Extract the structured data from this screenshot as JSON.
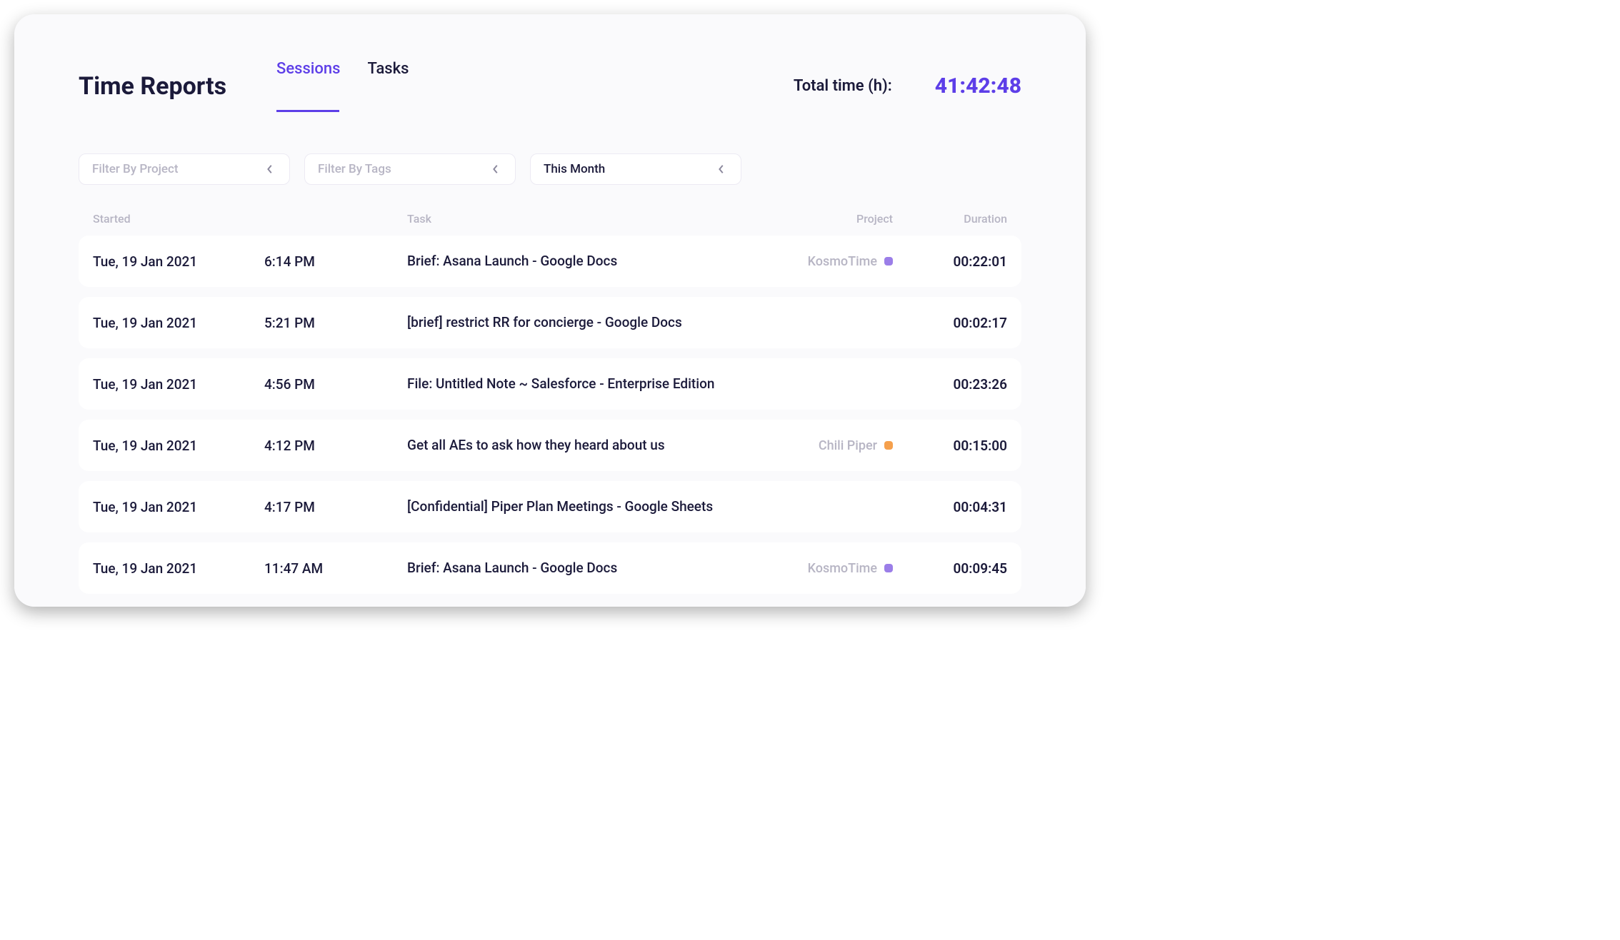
{
  "header": {
    "title": "Time Reports",
    "tabs": [
      {
        "label": "Sessions",
        "active": true
      },
      {
        "label": "Tasks",
        "active": false
      }
    ],
    "total_time_label": "Total time (h):",
    "total_time_value": "41:42:48"
  },
  "filters": {
    "project": {
      "placeholder": "Filter By Project",
      "value": ""
    },
    "tags": {
      "placeholder": "Filter By Tags",
      "value": ""
    },
    "period": {
      "value": "This Month"
    }
  },
  "table": {
    "columns": {
      "started": "Started",
      "task": "Task",
      "project": "Project",
      "duration": "Duration"
    },
    "rows": [
      {
        "date": "Tue, 19 Jan 2021",
        "time": "6:14 PM",
        "task": "Brief: Asana Launch - Google Docs",
        "project": "KosmoTime",
        "project_color": "purple",
        "duration": "00:22:01"
      },
      {
        "date": "Tue, 19 Jan 2021",
        "time": "5:21 PM",
        "task": "[brief] restrict RR for concierge - Google Docs",
        "project": "",
        "project_color": "",
        "duration": "00:02:17"
      },
      {
        "date": "Tue, 19 Jan 2021",
        "time": "4:56 PM",
        "task": "File: Untitled Note ~ Salesforce - Enterprise Edition",
        "project": "",
        "project_color": "",
        "duration": "00:23:26"
      },
      {
        "date": "Tue, 19 Jan 2021",
        "time": "4:12 PM",
        "task": "Get all AEs to ask how they heard about us",
        "project": "Chili Piper",
        "project_color": "orange",
        "duration": "00:15:00"
      },
      {
        "date": "Tue, 19 Jan 2021",
        "time": "4:17 PM",
        "task": "[Confidential] Piper Plan Meetings - Google Sheets",
        "project": "",
        "project_color": "",
        "duration": "00:04:31"
      },
      {
        "date": "Tue, 19 Jan 2021",
        "time": "11:47 AM",
        "task": "Brief: Asana Launch - Google Docs",
        "project": "KosmoTime",
        "project_color": "purple",
        "duration": "00:09:45"
      }
    ]
  }
}
